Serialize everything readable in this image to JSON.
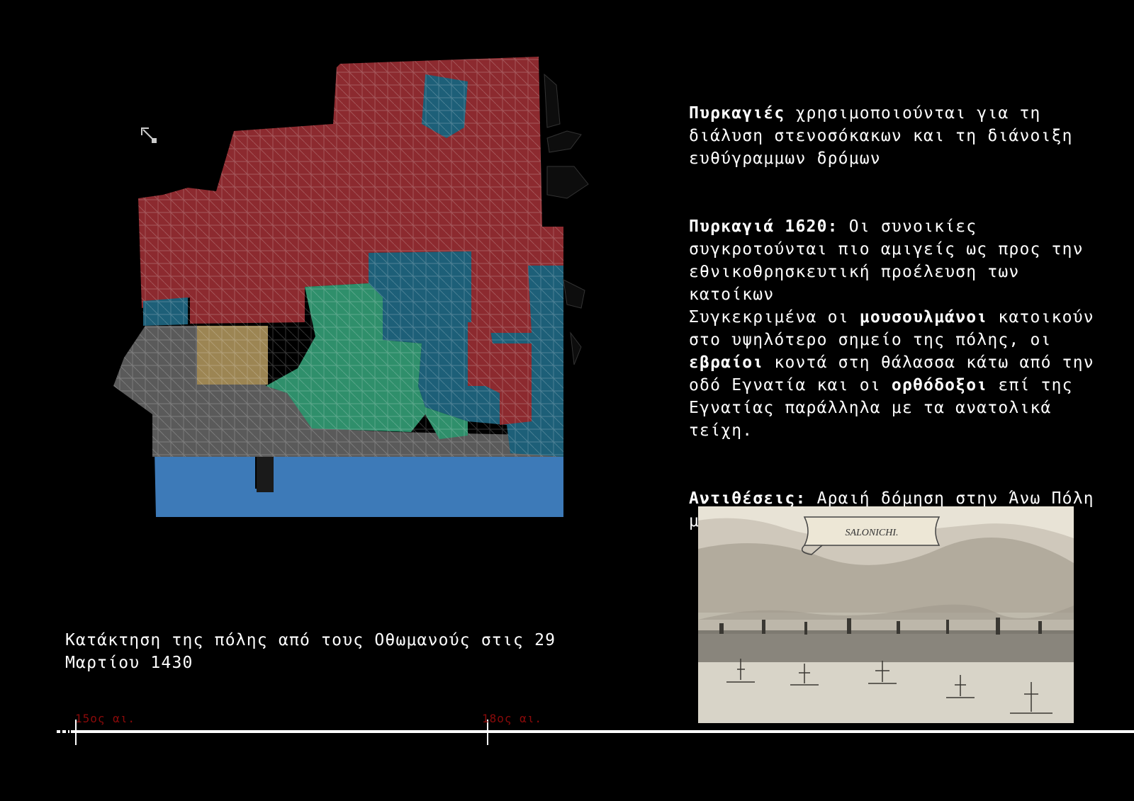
{
  "intro": {
    "bold": "Πυρκαγιές",
    "rest": " χρησιμοποιούνται για τη διάλυση στενοσόκακων και τη διάνοιξη ευθύγραμμων δρόμων"
  },
  "fire1620": {
    "bold": "Πυρκαγιά 1620:",
    "part1": " Οι συνοικίες συγκροτούνται πιο αμιγείς ως προς την εθνικοθρησκευτική προέλευση των κατοίκων\nΣυγκεκριμένα οι ",
    "muslims": "μουσουλμάνοι",
    "part2": " κατοικούν στο υψηλότερο σημείο της πόλης, οι ",
    "jews": "εβραίοι",
    "part3": " κοντά στη θάλασσα κάτω από την οδό Εγνατία και οι ",
    "orthodox": "ορθόδοξοι",
    "part4": " επί της Εγνατίας παράλληλα με τα ανατολικά τείχη."
  },
  "contrasts": {
    "bold": "Αντιθέσεις:",
    "rest": " Αραιή δόμηση στην Άνω Πόλη με αυλές - πυκνοδομεμένη Κάτω Πόλη"
  },
  "engraving": {
    "banner": "SALONICHI."
  },
  "caption": "Κατάκτηση της πόλης από τους Οθωμανούς στις 29 Μαρτίου 1430",
  "timeline": {
    "ticks": [
      "15ος αι.",
      "18ος αι."
    ]
  },
  "colors": {
    "muslim": "#8c2a2f",
    "jewish_blue": "#1d5f78",
    "orthodox_green": "#2f8f6b",
    "other_gray": "#5a5a5a",
    "tan": "#9c8553",
    "sea": "#3d7ab8",
    "tick": "#8b0a0a"
  },
  "icons": {
    "north_arrow": "north-arrow-icon"
  }
}
